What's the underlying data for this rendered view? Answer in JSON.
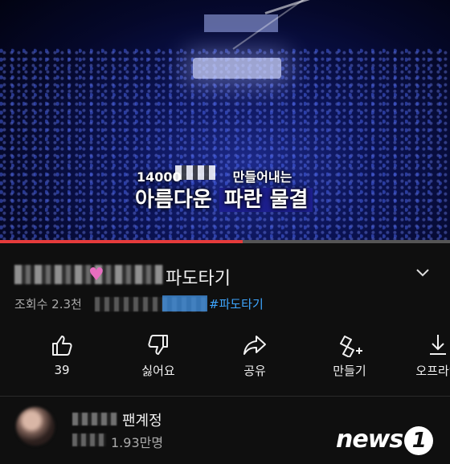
{
  "video": {
    "caption_line1": "14000",
    "caption_line1_end": "만들어내는",
    "caption_line2_a": "아름다운 ",
    "caption_line2_b": "파란 물결",
    "progress": 0.54
  },
  "title": {
    "text": "파도타기",
    "expand_icon": "chevron-down-icon"
  },
  "meta": {
    "views": "조회수 2.3천",
    "hashtag": "#파도타기"
  },
  "actions": [
    {
      "icon": "like-icon",
      "label": "39"
    },
    {
      "icon": "dislike-icon",
      "label": "싫어요"
    },
    {
      "icon": "share-icon",
      "label": "공유"
    },
    {
      "icon": "remix-icon",
      "label": "만들기"
    },
    {
      "icon": "download-icon",
      "label": "오프라인"
    }
  ],
  "channel": {
    "name": "팬계정",
    "subscribers": "1.93만명"
  },
  "watermark": {
    "text": "news",
    "num": "1"
  },
  "colors": {
    "background": "#0f0f0f",
    "progress": "#e53b3b",
    "hashtag": "#3ea6ff",
    "caption_highlight": "#1d1f8f"
  }
}
